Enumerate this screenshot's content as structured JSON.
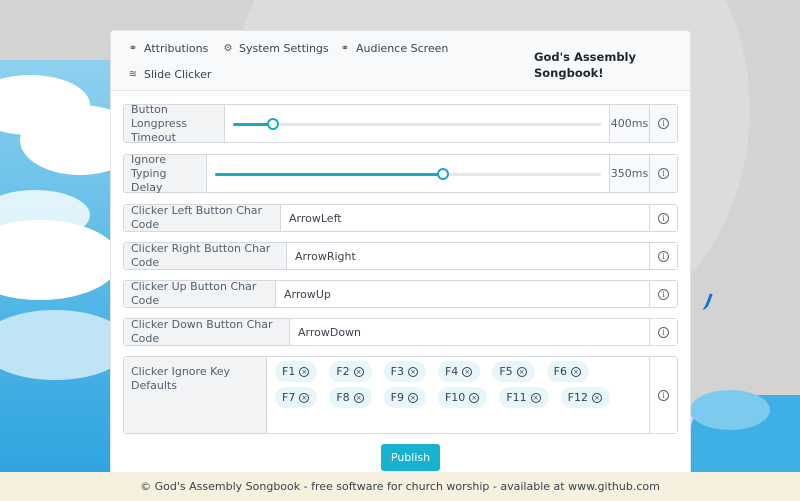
{
  "nav": {
    "items": [
      {
        "label": "Attributions",
        "icon": "link-icon"
      },
      {
        "label": "System Settings",
        "icon": "gear-icon"
      },
      {
        "label": "Audience Screen",
        "icon": "link-icon"
      },
      {
        "label": "Slide Clicker",
        "icon": "wifi-icon"
      }
    ],
    "brand_line1": "God's Assembly",
    "brand_line2": "Songbook!"
  },
  "settings": {
    "longpress": {
      "label_line1": "Button Longpress",
      "label_line2": "Timeout",
      "value": "400ms",
      "fraction": 0.11
    },
    "typing": {
      "label_line1": "Ignore Typing",
      "label_line2": "Delay",
      "value": "350ms",
      "fraction": 0.59
    },
    "left": {
      "label": "Clicker Left Button Char Code",
      "value": "ArrowLeft"
    },
    "right": {
      "label": "Clicker Right Button Char Code",
      "value": "ArrowRight"
    },
    "up": {
      "label": "Clicker Up Button Char Code",
      "value": "ArrowUp"
    },
    "down": {
      "label": "Clicker Down Button Char Code",
      "value": "ArrowDown"
    },
    "ignore": {
      "label": "Clicker Ignore Key Defaults",
      "keys": [
        "F1",
        "F2",
        "F3",
        "F4",
        "F5",
        "F6",
        "F7",
        "F8",
        "F9",
        "F10",
        "F11",
        "F12"
      ]
    }
  },
  "publish_label": "Publish",
  "footer": "© God's Assembly Songbook - free software for church worship - available at www.github.com",
  "colors": {
    "accent": "#17b1d1",
    "footer_bg": "#f6f1de"
  }
}
